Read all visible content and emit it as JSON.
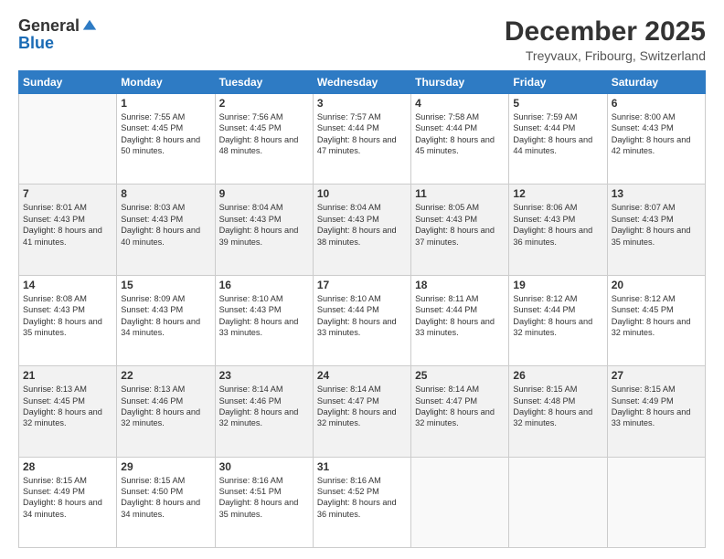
{
  "logo": {
    "general": "General",
    "blue": "Blue"
  },
  "header": {
    "month": "December 2025",
    "location": "Treyvaux, Fribourg, Switzerland"
  },
  "days_of_week": [
    "Sunday",
    "Monday",
    "Tuesday",
    "Wednesday",
    "Thursday",
    "Friday",
    "Saturday"
  ],
  "weeks": [
    [
      {
        "day": "",
        "sunrise": "",
        "sunset": "",
        "daylight": "",
        "empty": true
      },
      {
        "day": "1",
        "sunrise": "Sunrise: 7:55 AM",
        "sunset": "Sunset: 4:45 PM",
        "daylight": "Daylight: 8 hours and 50 minutes."
      },
      {
        "day": "2",
        "sunrise": "Sunrise: 7:56 AM",
        "sunset": "Sunset: 4:45 PM",
        "daylight": "Daylight: 8 hours and 48 minutes."
      },
      {
        "day": "3",
        "sunrise": "Sunrise: 7:57 AM",
        "sunset": "Sunset: 4:44 PM",
        "daylight": "Daylight: 8 hours and 47 minutes."
      },
      {
        "day": "4",
        "sunrise": "Sunrise: 7:58 AM",
        "sunset": "Sunset: 4:44 PM",
        "daylight": "Daylight: 8 hours and 45 minutes."
      },
      {
        "day": "5",
        "sunrise": "Sunrise: 7:59 AM",
        "sunset": "Sunset: 4:44 PM",
        "daylight": "Daylight: 8 hours and 44 minutes."
      },
      {
        "day": "6",
        "sunrise": "Sunrise: 8:00 AM",
        "sunset": "Sunset: 4:43 PM",
        "daylight": "Daylight: 8 hours and 42 minutes."
      }
    ],
    [
      {
        "day": "7",
        "sunrise": "Sunrise: 8:01 AM",
        "sunset": "Sunset: 4:43 PM",
        "daylight": "Daylight: 8 hours and 41 minutes."
      },
      {
        "day": "8",
        "sunrise": "Sunrise: 8:03 AM",
        "sunset": "Sunset: 4:43 PM",
        "daylight": "Daylight: 8 hours and 40 minutes."
      },
      {
        "day": "9",
        "sunrise": "Sunrise: 8:04 AM",
        "sunset": "Sunset: 4:43 PM",
        "daylight": "Daylight: 8 hours and 39 minutes."
      },
      {
        "day": "10",
        "sunrise": "Sunrise: 8:04 AM",
        "sunset": "Sunset: 4:43 PM",
        "daylight": "Daylight: 8 hours and 38 minutes."
      },
      {
        "day": "11",
        "sunrise": "Sunrise: 8:05 AM",
        "sunset": "Sunset: 4:43 PM",
        "daylight": "Daylight: 8 hours and 37 minutes."
      },
      {
        "day": "12",
        "sunrise": "Sunrise: 8:06 AM",
        "sunset": "Sunset: 4:43 PM",
        "daylight": "Daylight: 8 hours and 36 minutes."
      },
      {
        "day": "13",
        "sunrise": "Sunrise: 8:07 AM",
        "sunset": "Sunset: 4:43 PM",
        "daylight": "Daylight: 8 hours and 35 minutes."
      }
    ],
    [
      {
        "day": "14",
        "sunrise": "Sunrise: 8:08 AM",
        "sunset": "Sunset: 4:43 PM",
        "daylight": "Daylight: 8 hours and 35 minutes."
      },
      {
        "day": "15",
        "sunrise": "Sunrise: 8:09 AM",
        "sunset": "Sunset: 4:43 PM",
        "daylight": "Daylight: 8 hours and 34 minutes."
      },
      {
        "day": "16",
        "sunrise": "Sunrise: 8:10 AM",
        "sunset": "Sunset: 4:43 PM",
        "daylight": "Daylight: 8 hours and 33 minutes."
      },
      {
        "day": "17",
        "sunrise": "Sunrise: 8:10 AM",
        "sunset": "Sunset: 4:44 PM",
        "daylight": "Daylight: 8 hours and 33 minutes."
      },
      {
        "day": "18",
        "sunrise": "Sunrise: 8:11 AM",
        "sunset": "Sunset: 4:44 PM",
        "daylight": "Daylight: 8 hours and 33 minutes."
      },
      {
        "day": "19",
        "sunrise": "Sunrise: 8:12 AM",
        "sunset": "Sunset: 4:44 PM",
        "daylight": "Daylight: 8 hours and 32 minutes."
      },
      {
        "day": "20",
        "sunrise": "Sunrise: 8:12 AM",
        "sunset": "Sunset: 4:45 PM",
        "daylight": "Daylight: 8 hours and 32 minutes."
      }
    ],
    [
      {
        "day": "21",
        "sunrise": "Sunrise: 8:13 AM",
        "sunset": "Sunset: 4:45 PM",
        "daylight": "Daylight: 8 hours and 32 minutes."
      },
      {
        "day": "22",
        "sunrise": "Sunrise: 8:13 AM",
        "sunset": "Sunset: 4:46 PM",
        "daylight": "Daylight: 8 hours and 32 minutes."
      },
      {
        "day": "23",
        "sunrise": "Sunrise: 8:14 AM",
        "sunset": "Sunset: 4:46 PM",
        "daylight": "Daylight: 8 hours and 32 minutes."
      },
      {
        "day": "24",
        "sunrise": "Sunrise: 8:14 AM",
        "sunset": "Sunset: 4:47 PM",
        "daylight": "Daylight: 8 hours and 32 minutes."
      },
      {
        "day": "25",
        "sunrise": "Sunrise: 8:14 AM",
        "sunset": "Sunset: 4:47 PM",
        "daylight": "Daylight: 8 hours and 32 minutes."
      },
      {
        "day": "26",
        "sunrise": "Sunrise: 8:15 AM",
        "sunset": "Sunset: 4:48 PM",
        "daylight": "Daylight: 8 hours and 32 minutes."
      },
      {
        "day": "27",
        "sunrise": "Sunrise: 8:15 AM",
        "sunset": "Sunset: 4:49 PM",
        "daylight": "Daylight: 8 hours and 33 minutes."
      }
    ],
    [
      {
        "day": "28",
        "sunrise": "Sunrise: 8:15 AM",
        "sunset": "Sunset: 4:49 PM",
        "daylight": "Daylight: 8 hours and 34 minutes."
      },
      {
        "day": "29",
        "sunrise": "Sunrise: 8:15 AM",
        "sunset": "Sunset: 4:50 PM",
        "daylight": "Daylight: 8 hours and 34 minutes."
      },
      {
        "day": "30",
        "sunrise": "Sunrise: 8:16 AM",
        "sunset": "Sunset: 4:51 PM",
        "daylight": "Daylight: 8 hours and 35 minutes."
      },
      {
        "day": "31",
        "sunrise": "Sunrise: 8:16 AM",
        "sunset": "Sunset: 4:52 PM",
        "daylight": "Daylight: 8 hours and 36 minutes."
      },
      {
        "day": "",
        "empty": true
      },
      {
        "day": "",
        "empty": true
      },
      {
        "day": "",
        "empty": true
      }
    ]
  ]
}
